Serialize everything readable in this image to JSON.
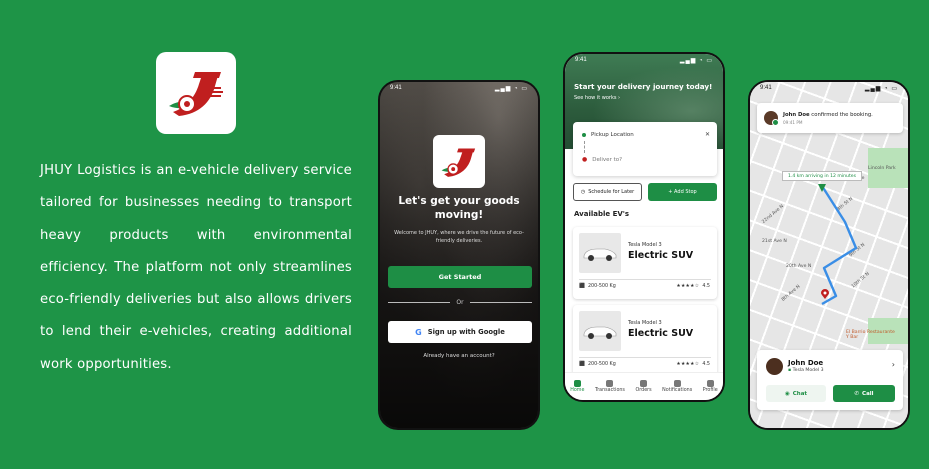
{
  "brand": {
    "description": "JHUY Logistics is an e-vehicle delivery service tailored for businesses needing to transport heavy products with environmental efficiency. The platform not only streamlines eco-friendly deliveries but also allows drivers to lend their e-vehicles, creating additional work opportunities.",
    "colors": {
      "background": "#1e9447",
      "primary": "#1e8e45",
      "logo_red": "#c01f1f"
    }
  },
  "screen_welcome": {
    "time": "9:41",
    "headline": "Let's get your goods moving!",
    "subtext": "Welcome to JHUY, where we drive the future of eco-friendly deliveries.",
    "get_started": "Get Started",
    "or": "Or",
    "google": "Sign up with Google",
    "already": "Already have an account?"
  },
  "screen_booking": {
    "time": "9:41",
    "title": "Start your delivery journey today!",
    "see_how": "See how it works",
    "pickup": "Pickup Location",
    "deliver": "Deliver to?",
    "schedule": "Schedule for Later",
    "add_stop": "+ Add Stop",
    "available": "Available EV's",
    "vehicles": [
      {
        "model": "Tesla Model 3",
        "type": "Electric SUV",
        "capacity": "200-500 Kg",
        "stars": "★★★★☆",
        "rating": "4.5"
      },
      {
        "model": "Tesla Model 3",
        "type": "Electric SUV",
        "capacity": "200-500 Kg",
        "stars": "★★★★☆",
        "rating": "4.5"
      }
    ],
    "nav": [
      "Home",
      "Transactions",
      "Orders",
      "Notifications",
      "Profile"
    ]
  },
  "screen_tracking": {
    "time": "9:41",
    "notification": {
      "name": "John Doe",
      "message": " confirmed the booking.",
      "time": "09:41 PM"
    },
    "eta": "1.4 km arriving in 12 minutes",
    "streets": [
      "23rd Ave",
      "22nd Ave N",
      "21st Ave N",
      "20th Ave N",
      "8th Ave N",
      "8th St N",
      "9th St N",
      "10th St N",
      "Lincoln Park",
      "El Barrio Restaurante Y Bar"
    ],
    "driver": {
      "name": "John Doe",
      "car": "Tesla Model 3"
    },
    "chat": "Chat",
    "call": "Call"
  }
}
